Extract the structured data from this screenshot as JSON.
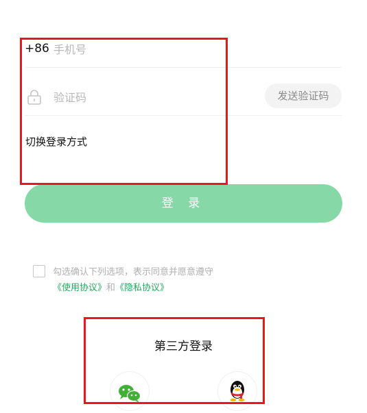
{
  "login_form": {
    "country_code": "+86",
    "phone_placeholder": "手机号",
    "code_placeholder": "验证码",
    "send_code_label": "发送验证码",
    "switch_method_label": "切换登录方式",
    "login_button_label": "登 录"
  },
  "agreement": {
    "text": "勾选确认下列选项，表示同意并愿意遵守",
    "user_agreement": "《使用协议》",
    "connector": "和",
    "privacy_policy": "《隐私协议》",
    "checked": false
  },
  "third_party": {
    "title": "第三方登录",
    "providers": [
      {
        "name": "wechat",
        "icon": "wechat-icon"
      },
      {
        "name": "qq",
        "icon": "qq-icon"
      }
    ]
  },
  "colors": {
    "accent": "#86d9a7",
    "link": "#1fab5a",
    "annotation": "#e51919"
  }
}
